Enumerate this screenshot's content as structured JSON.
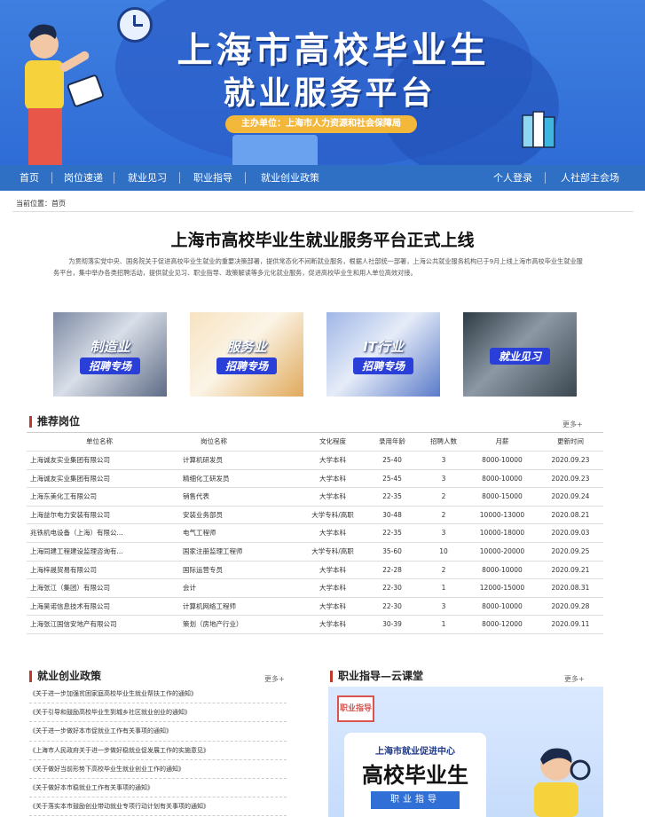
{
  "banner": {
    "title_line1": "上海市高校毕业生",
    "title_line2": "就业服务平台",
    "sponsor": "主办单位：上海市人力资源和社会保障局"
  },
  "nav": {
    "items": [
      "首页",
      "岗位速递",
      "就业见习",
      "职业指导",
      "就业创业政策"
    ],
    "right": [
      "个人登录",
      "人社部主会场"
    ]
  },
  "breadcrumb": "当前位置：首页",
  "headline": "上海市高校毕业生就业服务平台正式上线",
  "intro": "为贯彻落实党中央、国务院关于促进高校毕业生就业的重要决策部署，提供常态化不间断就业服务，根据人社部统一部署，上海公共就业服务机构已于9月上线上海市高校毕业生就业服务平台，集中举办各类招聘活动，提供就业见习、职业指导、政策解读等多元化就业服务，促进高校毕业生和用人单位高效对接。",
  "promos": [
    {
      "label": "制造业",
      "sub": "招聘专场",
      "icon": "gear-icon"
    },
    {
      "label": "服务业",
      "sub": "招聘专场",
      "icon": "service-icon"
    },
    {
      "label": "IT行业",
      "sub": "招聘专场",
      "icon": "tech-icon"
    },
    {
      "label": "就业见习",
      "sub": "",
      "icon": "building-icon"
    }
  ],
  "jobs": {
    "title": "推荐岗位",
    "more": "更多+",
    "columns": [
      "单位名称",
      "岗位名称",
      "文化程度",
      "录用年龄",
      "招聘人数",
      "月薪",
      "更新时间"
    ],
    "rows": [
      [
        "上海诚友实业集团有限公司",
        "计算机研发员",
        "大学本科",
        "25-40",
        "3",
        "8000-10000",
        "2020.09.23"
      ],
      [
        "上海诚友实业集团有限公司",
        "精细化工研发员",
        "大学本科",
        "25-45",
        "3",
        "8000-10000",
        "2020.09.23"
      ],
      [
        "上海东美化工有限公司",
        "销售代表",
        "大学本科",
        "22-35",
        "2",
        "8000-15000",
        "2020.09.24"
      ],
      [
        "上海益尔电力安装有限公司",
        "安装业务部员",
        "大学专科/高职",
        "30-48",
        "2",
        "10000-13000",
        "2020.08.21"
      ],
      [
        "兆铁机电设备（上海）有限公...",
        "电气工程师",
        "大学本科",
        "22-35",
        "3",
        "10000-18000",
        "2020.09.03"
      ],
      [
        "上海同建工程建设监理咨询有...",
        "国家注册监理工程师",
        "大学专科/高职",
        "35-60",
        "10",
        "10000-20000",
        "2020.09.25"
      ],
      [
        "上海梓晟贸易有限公司",
        "国际运营专员",
        "大学本科",
        "22-28",
        "2",
        "8000-10000",
        "2020.09.21"
      ],
      [
        "上海张江（集团）有限公司",
        "会计",
        "大学本科",
        "22-30",
        "1",
        "12000-15000",
        "2020.08.31"
      ],
      [
        "上海昊诺信息技术有限公司",
        "计算机网络工程师",
        "大学本科",
        "22-30",
        "3",
        "8000-10000",
        "2020.09.28"
      ],
      [
        "上海张江国信安地产有限公司",
        "策划（房地产行业）",
        "大学本科",
        "30-39",
        "1",
        "8000-12000",
        "2020.09.11"
      ]
    ]
  },
  "policies": {
    "title": "就业创业政策",
    "more": "更多+",
    "items": [
      "《关于进一步加强贫困家庭高校毕业生就业帮扶工作的通知》",
      "《关于引导和鼓励高校毕业生到城乡社区就业创业的通知》",
      "《关于进一步做好本市促就业工作有关事项的通知》",
      "《上海市人民政府关于进一步做好稳就业促发展工作的实施意见》",
      "《关于做好当前形势下高校毕业生就业创业工作的通知》",
      "《关于做好本市稳就业工作有关事项的通知》",
      "《关于落实本市鼓励创业带动就业专项行动计划有关事项的通知》"
    ]
  },
  "guidance": {
    "title": "职业指导—云课堂",
    "more": "更多+",
    "image_logo": "职业指导",
    "image_line1": "上海市就业促进中心",
    "image_line2": "高校毕业生",
    "image_line3": "职业指导"
  },
  "colors": {
    "primary": "#2f6fc4",
    "banner": "#3f7fe0",
    "accent": "#c0392b"
  }
}
